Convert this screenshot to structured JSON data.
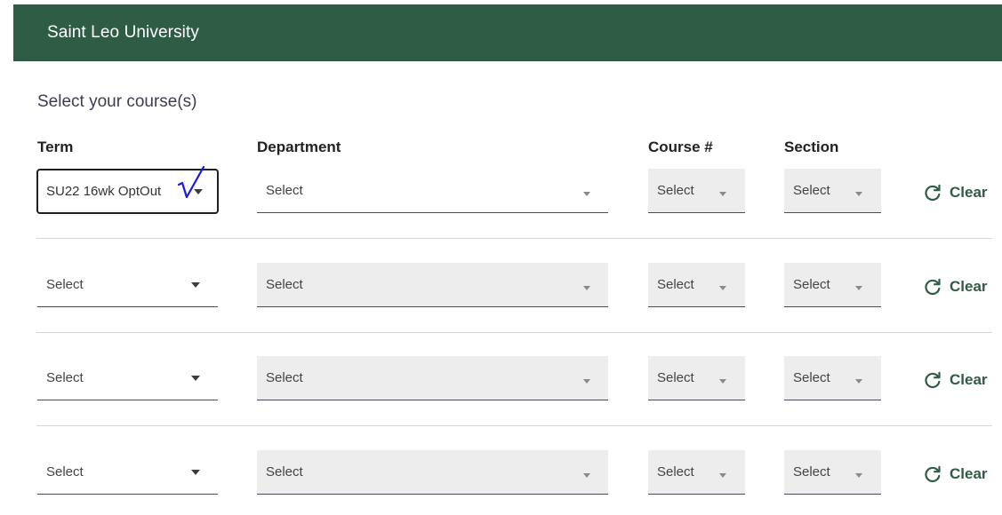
{
  "app": {
    "title": "Saint Leo University"
  },
  "colors": {
    "header_bg": "#2f5c44",
    "accent": "#2f5c44",
    "checkmark": "#1a1ae6"
  },
  "section_title": "Select your course(s)",
  "columns": {
    "term": "Term",
    "department": "Department",
    "course": "Course #",
    "section": "Section"
  },
  "rows": [
    {
      "term": "SU22 16wk OptOut",
      "department": "Select",
      "course": "Select",
      "section": "Select",
      "clear": "Clear"
    },
    {
      "term": "Select",
      "department": "Select",
      "course": "Select",
      "section": "Select",
      "clear": "Clear"
    },
    {
      "term": "Select",
      "department": "Select",
      "course": "Select",
      "section": "Select",
      "clear": "Clear"
    },
    {
      "term": "Select",
      "department": "Select",
      "course": "Select",
      "section": "Select",
      "clear": "Clear"
    }
  ],
  "icons": {
    "refresh": "refresh-icon",
    "dropdown": "chevron-down-icon",
    "checkmark": "checkmark-icon"
  }
}
